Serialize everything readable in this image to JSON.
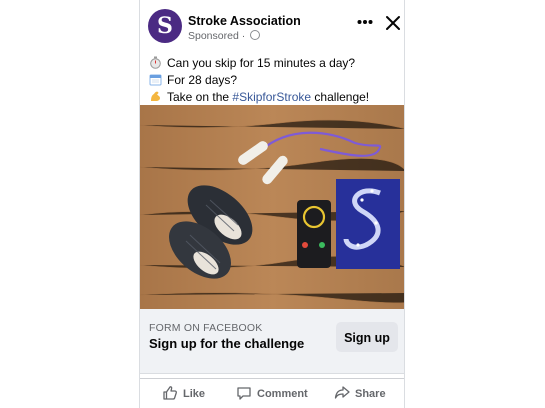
{
  "post": {
    "page_name": "Stroke Association",
    "avatar_letter": "S",
    "sponsored": "Sponsored ·",
    "lines": [
      "Can you skip for 15 minutes a day?",
      "For 28 days?",
      "Take on the"
    ],
    "hashtag": "#SkipforStroke",
    "challenge_suffix": " challenge!"
  },
  "form": {
    "label": "FORM ON FACEBOOK",
    "title": "Sign up for the challenge",
    "button": "Sign up"
  },
  "actions": {
    "like": "Like",
    "comment": "Comment",
    "share": "Share"
  },
  "colors": {
    "brand": "#4b2a83",
    "link": "#385898",
    "form_bg": "#f0f2f5",
    "button_bg": "#e4e6eb",
    "table_wood": "#b07d50"
  },
  "icons": [
    "more-icon",
    "close-icon",
    "globe-icon",
    "stopwatch-icon",
    "calendar-icon",
    "flexed-biceps-icon",
    "like-icon",
    "comment-icon",
    "share-icon"
  ]
}
